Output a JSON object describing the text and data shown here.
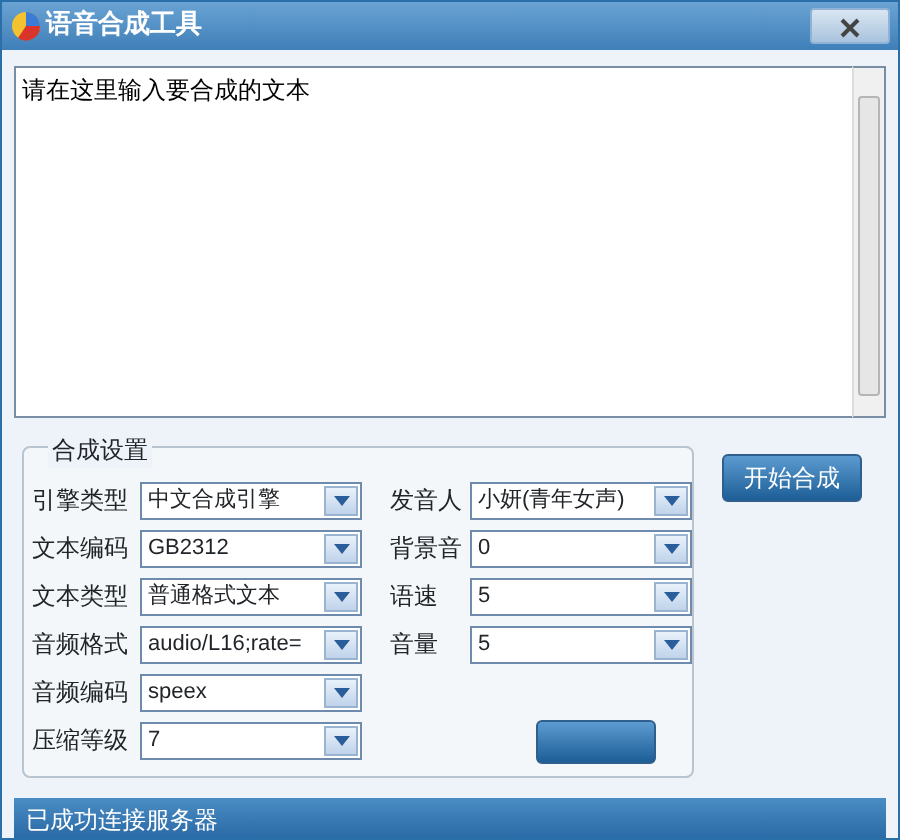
{
  "window": {
    "title": "语音合成工具"
  },
  "text_input": {
    "value": "请在这里输入要合成的文本"
  },
  "settings": {
    "title": "合成设置",
    "left_fields": [
      {
        "label": "引擎类型",
        "value": "中文合成引擎"
      },
      {
        "label": "文本编码",
        "value": "GB2312"
      },
      {
        "label": "文本类型",
        "value": "普通格式文本"
      },
      {
        "label": "音频格式",
        "value": "audio/L16;rate="
      },
      {
        "label": "音频编码",
        "value": "speex"
      },
      {
        "label": "压缩等级",
        "value": "7"
      }
    ],
    "right_fields": [
      {
        "label": "发音人",
        "value": "小妍(青年女声)"
      },
      {
        "label": "背景音",
        "value": "0"
      },
      {
        "label": "语速",
        "value": "5"
      },
      {
        "label": "音量",
        "value": "5"
      }
    ]
  },
  "start_button": {
    "label": "开始合成"
  },
  "status_bar": {
    "text": "已成功连接服务器"
  }
}
